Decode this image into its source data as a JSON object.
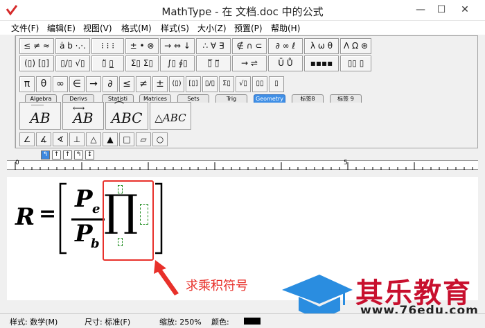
{
  "window": {
    "title": "MathType - 在 文档.doc 中的公式",
    "minimize": "—",
    "maximize": "☐",
    "close": "✕"
  },
  "menu": [
    {
      "label": "文件(F)"
    },
    {
      "label": "编辑(E)"
    },
    {
      "label": "视图(V)"
    },
    {
      "label": "格式(M)"
    },
    {
      "label": "样式(S)"
    },
    {
      "label": "大小(Z)"
    },
    {
      "label": "预置(P)"
    },
    {
      "label": "帮助(H)"
    }
  ],
  "symbol_palettes": {
    "row1": [
      "≤ ≠ ≈",
      "ȧ b ·.·.",
      "⁝ ⁝ ⁝",
      "± • ⊗",
      "→ ⇔ ↓",
      "∴ ∀ ∃",
      "∉ ∩ ⊂",
      "∂ ∞ ℓ",
      "λ ω θ",
      "Λ Ω ⊛"
    ],
    "row2": [
      "(▯) [▯]",
      "▯/▯ √▯",
      "▯̈ ▯̲",
      "Σ▯ Σ▯",
      "∫▯ ∮▯",
      "▯̅ ▯⃡",
      "→ ⇌",
      "Ū Ů",
      "▪▪▪▪",
      "▯▯ ▯"
    ]
  },
  "small_symbols": [
    "π",
    "θ",
    "∞",
    "∈",
    "→",
    "∂",
    "≤",
    "≠",
    "±",
    "(▯)",
    "[▯]",
    "▯/▯",
    "Σ▯",
    "√▯",
    "▯▯",
    "▯"
  ],
  "tabs": [
    {
      "label": "Algebra",
      "active": false
    },
    {
      "label": "Derivs",
      "active": false
    },
    {
      "label": "Statisti",
      "active": false
    },
    {
      "label": "Matrices",
      "active": false
    },
    {
      "label": "Sets",
      "active": false
    },
    {
      "label": "Trig",
      "active": false
    },
    {
      "label": "Geometry",
      "active": true
    },
    {
      "label": "标签8",
      "active": false
    },
    {
      "label": "标签 9",
      "active": false
    }
  ],
  "geometry_templates": [
    "AB",
    "AB",
    "ABC",
    "△ABC"
  ],
  "geometry_symbols": [
    "∠",
    "∡",
    "∢",
    "⊥",
    "△",
    "▲",
    "□",
    "▱",
    "○"
  ],
  "size_buttons": [
    "↰",
    "↑",
    "↑",
    "↰",
    "↕"
  ],
  "ruler": {
    "mark0": "0",
    "mark5": "5"
  },
  "equation": {
    "lhs": "R",
    "equals": "=",
    "numerator": "P",
    "numerator_sub": "e",
    "denominator": "P",
    "denominator_sub": "b",
    "operator": "∏"
  },
  "annotation": "求乘积符号",
  "status": {
    "style": "样式: 数学(M)",
    "size": "尺寸: 标准(F)",
    "zoom": "缩放: 250%",
    "color": "颜色:"
  },
  "watermark": {
    "name": "其乐教育",
    "url": "www.76edu.com"
  },
  "colors": {
    "active_tab": "#3f8fe6",
    "annotation": "#e8302a",
    "highlight_box": "#e8302a",
    "placeholder": "#1e8c1e",
    "watermark_name": "#c8102e",
    "logo_blue": "#2a8de0"
  }
}
